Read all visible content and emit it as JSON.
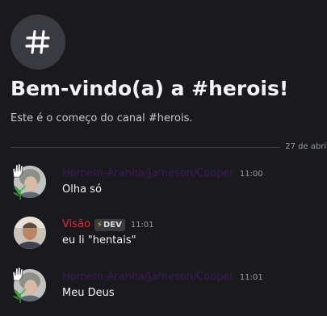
{
  "channel": {
    "icon": "hashtag-icon",
    "welcome_title": "Bem-vindo(a) a #herois!",
    "welcome_subtitle": "Este é o começo do canal #herois."
  },
  "divider": {
    "date": "27 de abril"
  },
  "messages": [
    {
      "username": "Homem-Aranha/Jameson/Cooper",
      "time": "11:00",
      "text": "Olha só",
      "avatar": "gray-hair-person-avatar"
    },
    {
      "username": "Visão",
      "tag": "DEV",
      "tag_icon": "lightning-icon",
      "time": "11:01",
      "text": "eu li \"hentais\"",
      "avatar": "man-photo-avatar"
    },
    {
      "username": "Homem-Aranha/Jameson/Cooper",
      "time": "11:01",
      "text": "Meu Deus",
      "avatar": "gray-hair-person-avatar"
    }
  ],
  "colors": {
    "background": "#1a1a1e",
    "username_dark": "#3b1a55",
    "username_red": "#e0282f",
    "tag_bolt": "#f5c400",
    "muted": "#949ba4"
  }
}
